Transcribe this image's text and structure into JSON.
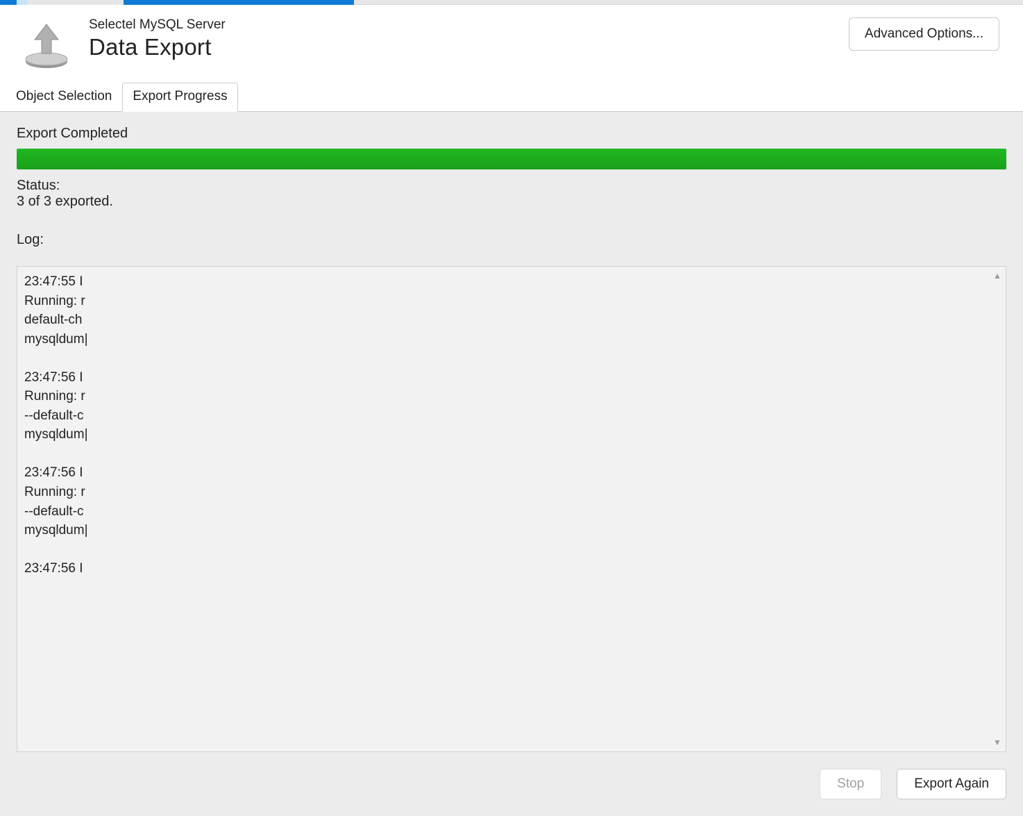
{
  "header": {
    "subtitle": "Selectel MySQL Server",
    "title": "Data Export",
    "advanced_button": "Advanced Options..."
  },
  "tabs": {
    "object_selection": "Object Selection",
    "export_progress": "Export Progress",
    "active": "export_progress"
  },
  "progress": {
    "completed_text": "Export Completed",
    "status_label": "Status:",
    "status_value": "3 of 3 exported.",
    "log_label": "Log:",
    "log_text": "23:47:55 I\nRunning: r\ndefault-ch\nmysqldum|\n\n23:47:56 I\nRunning: r\n--default-c\nmysqldum|\n\n23:47:56 I\nRunning: r\n--default-c\nmysqldum|\n\n23:47:56 I"
  },
  "buttons": {
    "stop": "Stop",
    "export_again": "Export Again"
  }
}
